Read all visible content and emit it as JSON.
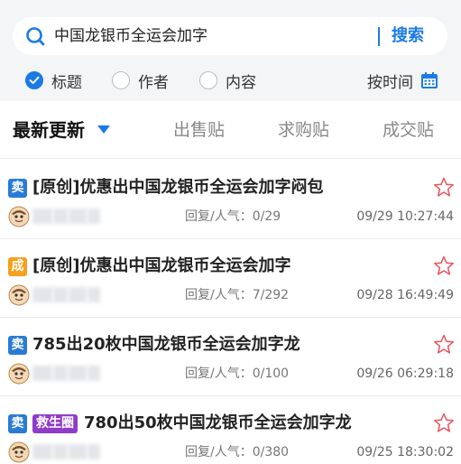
{
  "search": {
    "value": "中国龙银币全运会加字",
    "button_label": "搜索"
  },
  "filters": {
    "options": [
      {
        "label": "标题",
        "checked": true
      },
      {
        "label": "作者",
        "checked": false
      },
      {
        "label": "内容",
        "checked": false
      }
    ],
    "sort_label": "按时间"
  },
  "tabs": [
    {
      "label": "最新更新",
      "active": true
    },
    {
      "label": "出售贴",
      "active": false
    },
    {
      "label": "求购贴",
      "active": false
    },
    {
      "label": "成交贴",
      "active": false
    }
  ],
  "posts": [
    {
      "badge": "卖",
      "badge_color": "#2a7bd6",
      "extra_badge": "",
      "title": "[原创]优惠出中国龙银币全运会加字闷包",
      "stats": "回复/人气：0/29",
      "time": "09/29 10:27:44"
    },
    {
      "badge": "成",
      "badge_color": "#f5a01f",
      "extra_badge": "",
      "title": "[原创]优惠出中国龙银币全运会加字",
      "stats": "回复/人气：7/292",
      "time": "09/28 16:49:49"
    },
    {
      "badge": "卖",
      "badge_color": "#2a7bd6",
      "extra_badge": "",
      "title": "785出20枚中国龙银币全运会加字龙",
      "stats": "回复/人气：0/100",
      "time": "09/26 06:29:18"
    },
    {
      "badge": "卖",
      "badge_color": "#2a7bd6",
      "extra_badge": "救生圈",
      "extra_badge_color": "#8e3cc9",
      "title": "780出50枚中国龙银币全运会加字龙",
      "stats": "回复/人气：0/380",
      "time": "09/25 18:30:02"
    }
  ],
  "colors": {
    "accent": "#1b7be6",
    "star": "#e8545c"
  }
}
